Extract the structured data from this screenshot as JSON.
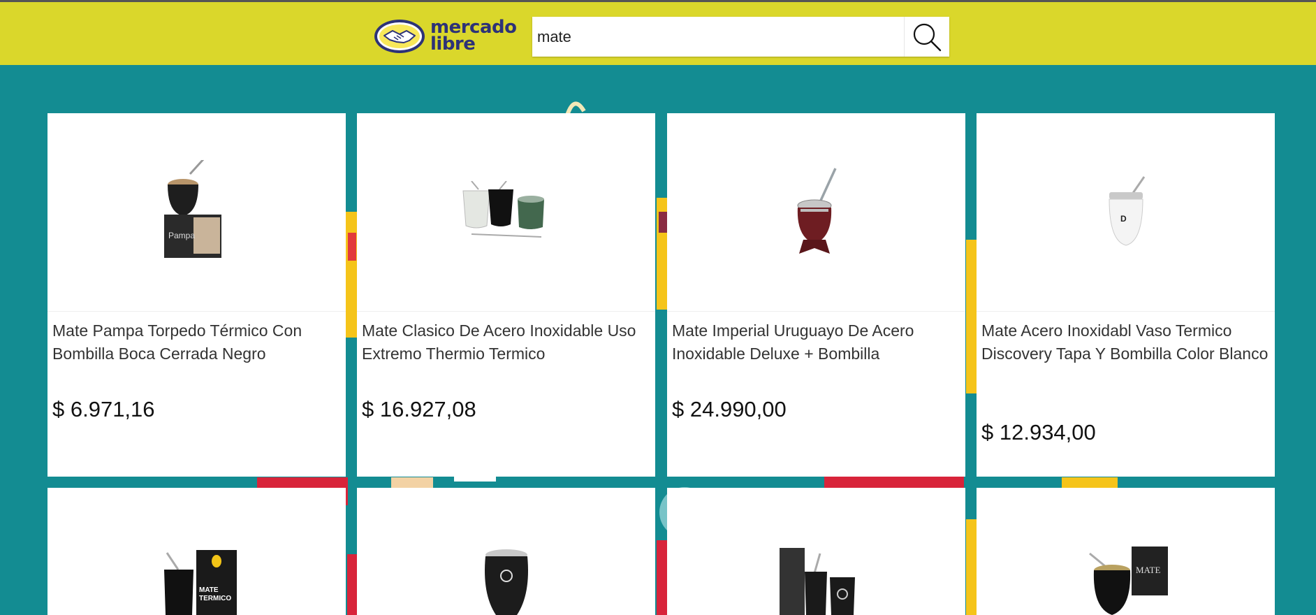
{
  "header": {
    "logo": {
      "line1": "mercado",
      "line2": "libre",
      "icon": "handshake-icon"
    },
    "search": {
      "value": "mate",
      "placeholder": "",
      "button_icon": "search-icon"
    },
    "colors": {
      "header_bg": "#dad72b",
      "page_bg": "#138c92",
      "logo_text": "#2d3277"
    }
  },
  "products": [
    {
      "title": "Mate Pampa Torpedo Térmico Con Bombilla Boca Cerrada Negro",
      "price": "$ 6.971,16"
    },
    {
      "title": "Mate Clasico De Acero Inoxidable Uso Extremo Thermio Termico",
      "price": "$ 16.927,08"
    },
    {
      "title": "Mate Imperial Uruguayo De Acero Inoxidable Deluxe + Bombilla",
      "price": "$ 24.990,00"
    },
    {
      "title": "Mate Acero Inoxidabl Vaso Termico Discovery Tapa Y Bombilla Color Blanco",
      "price": "$ 12.934,00"
    },
    {
      "title": "",
      "price": ""
    },
    {
      "title": "",
      "price": ""
    },
    {
      "title": "",
      "price": ""
    },
    {
      "title": "",
      "price": ""
    }
  ]
}
